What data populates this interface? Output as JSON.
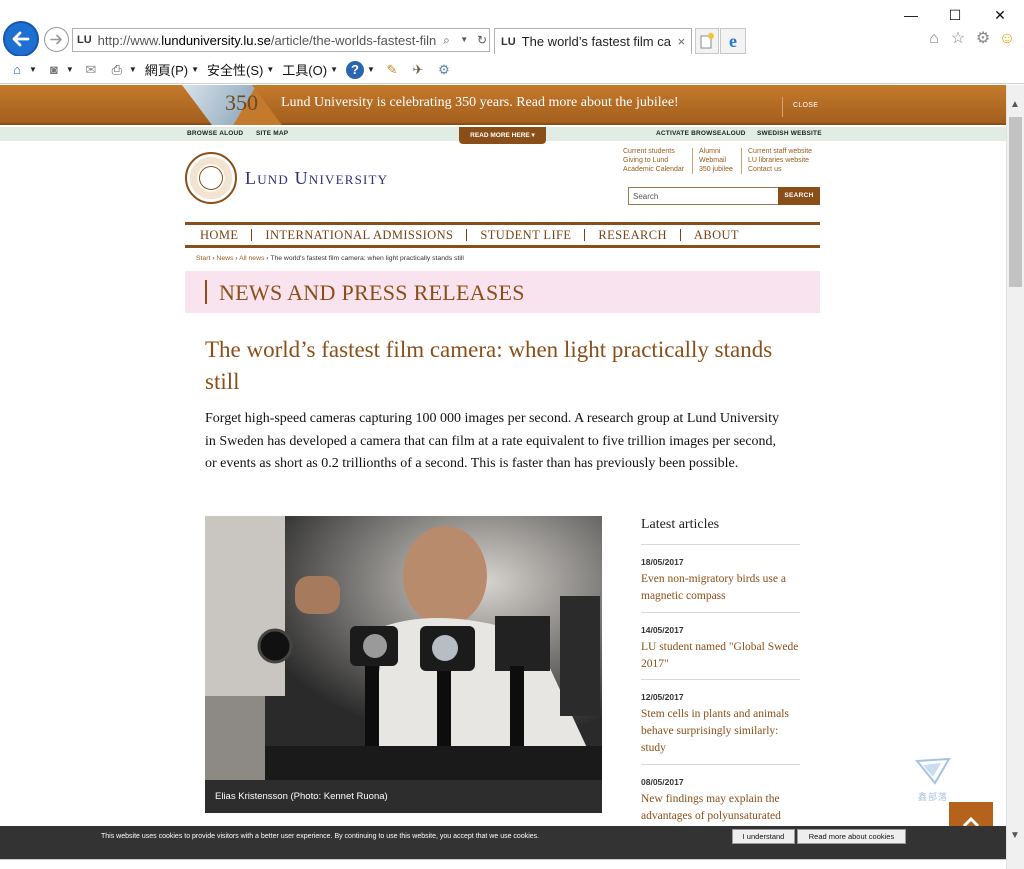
{
  "browser": {
    "address": {
      "favicon": "LU",
      "url_prefix": "http://www.",
      "url_domain": "lunduniversity.lu.se",
      "url_path": "/article/the-worlds-fastest-filn"
    },
    "tab": {
      "favicon": "LU",
      "title": "The world’s fastest film ca...",
      "close": "×"
    },
    "window": {
      "minimize": "—",
      "maximize": "☐",
      "close": "✕"
    },
    "command_bar": {
      "page_menu": "網頁(P)",
      "safety_menu": "安全性(S)",
      "tools_menu": "工具(O)"
    }
  },
  "site": {
    "jubilee": {
      "logo_text": "350",
      "message": "Lund University is celebrating 350 years. Read more about the jubilee!",
      "close": "CLOSE"
    },
    "util": {
      "browse_aloud": "BROWSE ALOUD",
      "site_map": "SITE MAP",
      "read_more_here": "READ MORE HERE ▾",
      "activate_browsealoud": "ACTIVATE BROWSEALOUD",
      "swedish_website": "SWEDISH WEBSITE"
    },
    "name": "Lund University",
    "quick_links": {
      "col1": [
        "Current students",
        "Giving to Lund",
        "Academic Calendar"
      ],
      "col2": [
        "Alumni",
        "Webmail",
        "350 jubilee"
      ],
      "col3": [
        "Current staff website",
        "LU libraries website",
        "Contact us"
      ]
    },
    "search": {
      "placeholder": "Search",
      "button": "SEARCH"
    },
    "nav": [
      "HOME",
      "INTERNATIONAL ADMISSIONS",
      "STUDENT LIFE",
      "RESEARCH",
      "ABOUT"
    ],
    "breadcrumb": {
      "items": [
        "Start",
        "News",
        "All news"
      ],
      "separator": " › ",
      "current": "The world's fastest film camera: when light practically stands still"
    },
    "section_title": "NEWS AND PRESS RELEASES"
  },
  "article": {
    "title": "The world’s fastest film camera: when light practically stands still",
    "lead": "Forget high-speed cameras capturing 100 000 images per second. A research group at Lund University in Sweden has developed a camera that can film at a rate equivalent to five trillion images per second, or events as short as 0.2 trillionths of a second. This is faster than has previously been possible.",
    "photo_caption": "Elias Kristensson (Photo: Kennet Ruona)"
  },
  "latest": {
    "title": "Latest articles",
    "items": [
      {
        "date": "18/05/2017",
        "title": "Even non-migratory birds use a magnetic compass"
      },
      {
        "date": "14/05/2017",
        "title": "LU student named \"Global Swede 2017\""
      },
      {
        "date": "12/05/2017",
        "title": "Stem cells in plants and animals behave surprisingly similarly: study"
      },
      {
        "date": "08/05/2017",
        "title": "New findings may explain the advantages of polyunsaturated"
      }
    ]
  },
  "watermark": {
    "text": "鑫部落"
  },
  "cookie": {
    "message": "This website uses cookies to provide visitors with a better user experience. By continuing to use this website, you accept that we use cookies.",
    "accept": "I understand",
    "more": "Read more about cookies"
  },
  "colors": {
    "brand": "#8a4f18",
    "nav_text": "#7a4315",
    "banner_pink": "#f9e3ee",
    "ie_blue": "#1d6fd1"
  }
}
